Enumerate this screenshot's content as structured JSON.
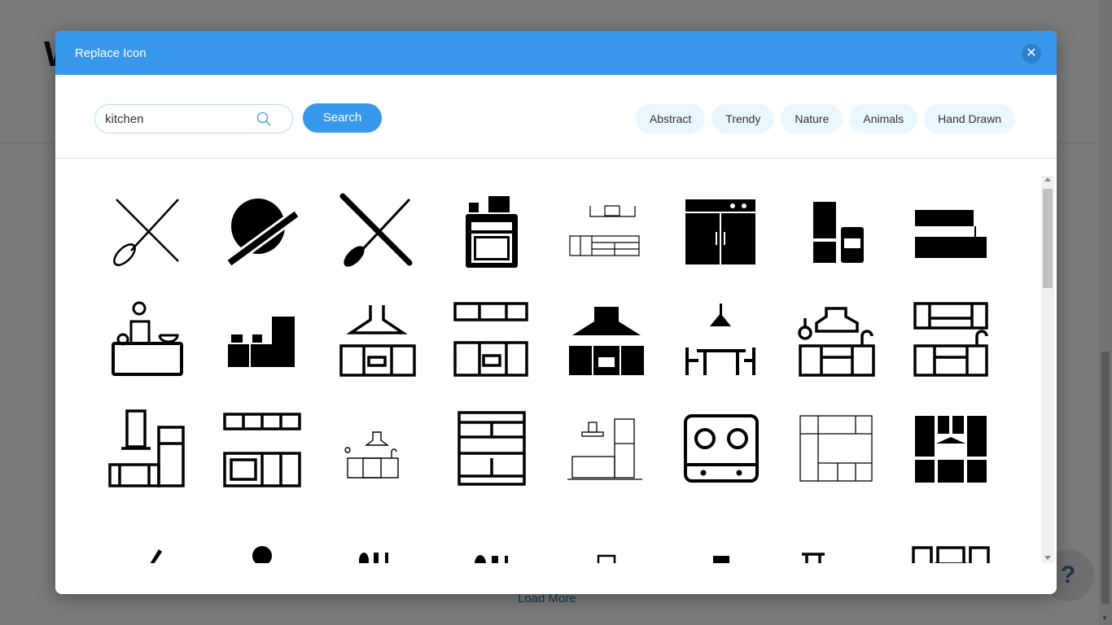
{
  "background": {
    "title_fragment": "W",
    "load_more_label": "Load More",
    "help_label": "?"
  },
  "modal": {
    "title": "Replace Icon",
    "close_icon": "close-icon",
    "search": {
      "value": "kitchen",
      "placeholder": "Search",
      "button_label": "Search",
      "icon": "search-icon"
    },
    "tags": [
      {
        "label": "Abstract"
      },
      {
        "label": "Trendy"
      },
      {
        "label": "Nature"
      },
      {
        "label": "Animals"
      },
      {
        "label": "Hand Drawn"
      }
    ],
    "icons": [
      {
        "name": "whisk-rolling-pin-outline-icon"
      },
      {
        "name": "rolling-pin-dough-icon"
      },
      {
        "name": "whisk-rolling-pin-solid-icon"
      },
      {
        "name": "stove-with-pot-icon"
      },
      {
        "name": "kitchen-counter-thin-icon"
      },
      {
        "name": "kitchen-cabinet-stove-solid-icon"
      },
      {
        "name": "fridge-and-oven-icon"
      },
      {
        "name": "kitchen-cabinets-set-icon"
      },
      {
        "name": "chef-cooking-counter-icon"
      },
      {
        "name": "kitchen-appliances-fridge-icon"
      },
      {
        "name": "range-hood-oven-outline-icon"
      },
      {
        "name": "cabinets-oven-outline-icon"
      },
      {
        "name": "range-hood-oven-solid-icon"
      },
      {
        "name": "pendant-lamp-dining-table-icon"
      },
      {
        "name": "kitchen-hood-sink-stove-icon"
      },
      {
        "name": "cabinets-stove-sink-icon"
      },
      {
        "name": "hood-counter-fridge-icon"
      },
      {
        "name": "cabinets-microwave-icon"
      },
      {
        "name": "small-kitchen-hood-stove-icon"
      },
      {
        "name": "kitchen-shelving-unit-icon"
      },
      {
        "name": "kitchen-line-art-fridge-icon"
      },
      {
        "name": "gas-cooktop-icon"
      },
      {
        "name": "kitchen-cabinets-line-icon"
      },
      {
        "name": "kitchen-cabinets-hood-solid-icon"
      },
      {
        "name": "chopstick-icon"
      },
      {
        "name": "spoon-icon"
      },
      {
        "name": "spoon-fork-knife-icon"
      },
      {
        "name": "cutlery-set-icon"
      },
      {
        "name": "range-hood-outline-icon"
      },
      {
        "name": "range-hood-solid-icon"
      },
      {
        "name": "utensils-counter-steam-icon"
      },
      {
        "name": "cabinets-hood-steam-icon"
      }
    ]
  }
}
